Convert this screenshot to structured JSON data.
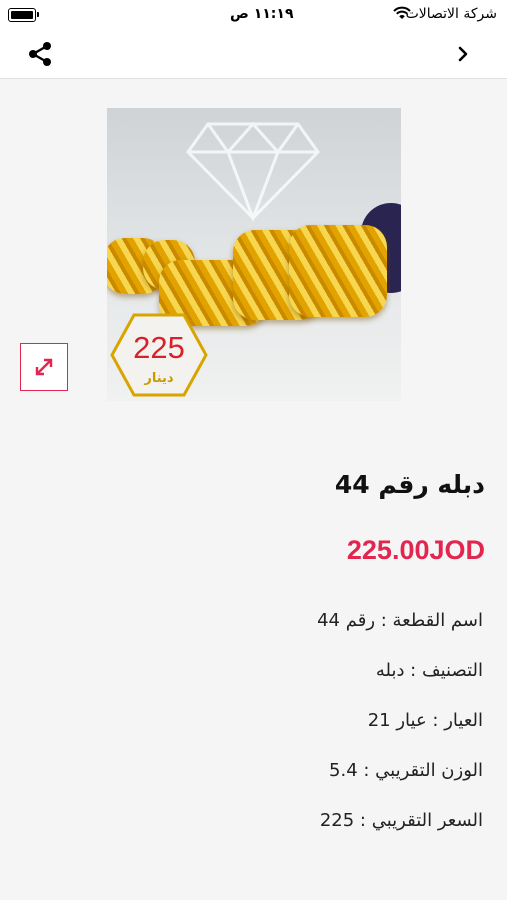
{
  "status_bar": {
    "carrier": "شركة الاتصالات",
    "time": "١١:١٩ ص"
  },
  "image": {
    "badge_number": "225",
    "badge_currency": "دينار"
  },
  "product": {
    "title": "دبله رقم 44",
    "price": "225.00JOD",
    "specs": [
      "اسم القطعة : رقم 44",
      "التصنيف : دبله",
      "العيار : عيار 21",
      "الوزن التقريبي : 5.4",
      "السعر التقريبي : 225"
    ]
  },
  "colors": {
    "accent": "#e2264f",
    "background": "#f5f5f5"
  },
  "icons": [
    "battery-icon",
    "wifi-icon",
    "share-icon",
    "back-chevron-icon",
    "expand-icon"
  ]
}
